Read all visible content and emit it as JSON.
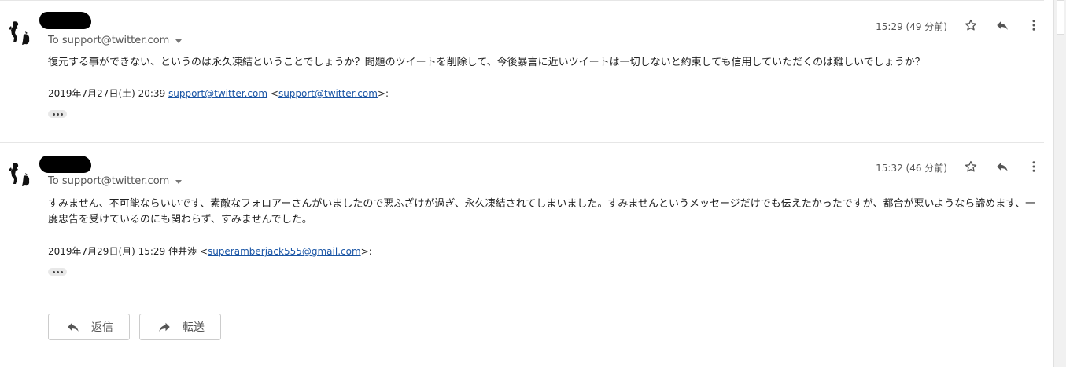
{
  "messages": [
    {
      "recipients": "To support@twitter.com",
      "time": "15:29 (49 分前)",
      "body": "復元する事ができない、というのは永久凍結ということでしょうか？問題のツイートを削除して、今後暴言に近いツイートは一切しないと約束しても信用していただくのは難しいでしょうか？",
      "quote_date": "2019年7月27日(土) 20:39",
      "quote_sender": "support@twitter.com",
      "quote_open": "<",
      "quote_email": "support@twitter.com",
      "quote_close": ">:"
    },
    {
      "recipients": "To support@twitter.com",
      "time": "15:32 (46 分前)",
      "body": "すみません、不可能ならいいです、素敵なフォロアーさんがいましたので悪ふざけが過ぎ、永久凍結されてしまいました。すみませんというメッセージだけでも伝えたかったですが、都合が悪いようなら諦めます、一度忠告を受けているのにも関わらず、すみませんでした。",
      "quote_date": "2019年7月29日(月) 15:29",
      "quote_sender": "仲井渉",
      "quote_open": "<",
      "quote_email": "superamberjack555@gmail.com",
      "quote_close": ">:"
    }
  ],
  "actions": {
    "reply_label": "返信",
    "forward_label": "転送"
  },
  "icons": {
    "star": "star-icon",
    "reply": "reply-icon",
    "more": "more-vert-icon",
    "forward": "forward-icon"
  },
  "colors": {
    "link": "#1a55a5",
    "redaction": "#000000"
  }
}
